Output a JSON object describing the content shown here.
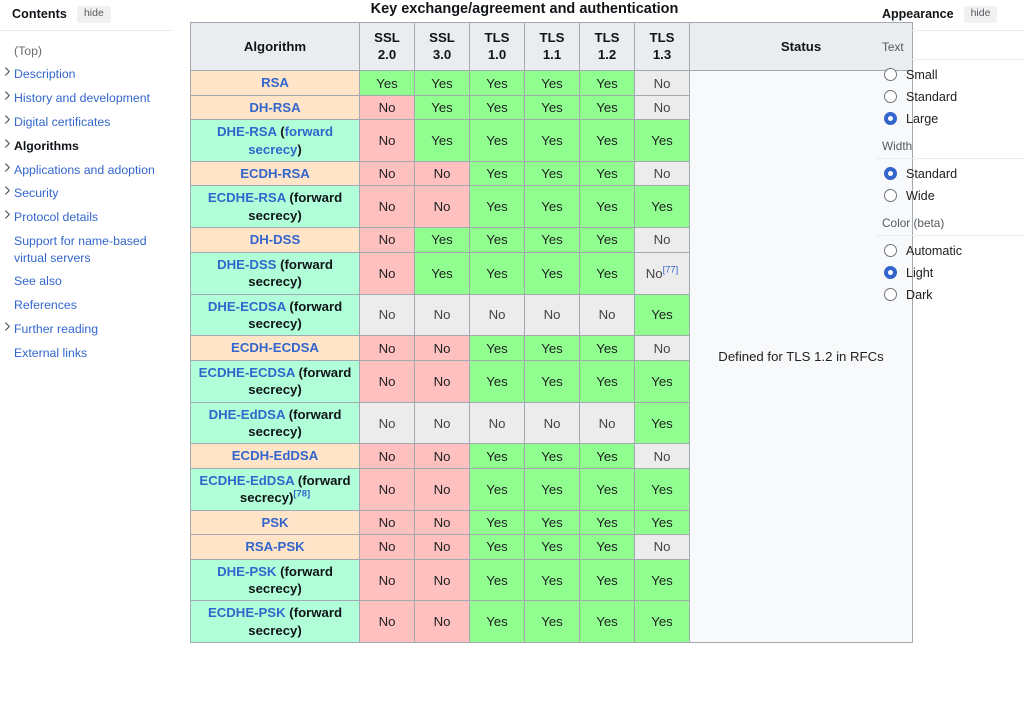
{
  "toc": {
    "title": "Contents",
    "hide_label": "hide",
    "items": [
      {
        "label": "(Top)",
        "expandable": false,
        "selected": false,
        "muted": true
      },
      {
        "label": "Description",
        "expandable": true,
        "selected": false
      },
      {
        "label": "History and development",
        "expandable": true,
        "selected": false
      },
      {
        "label": "Digital certificates",
        "expandable": true,
        "selected": false
      },
      {
        "label": "Algorithms",
        "expandable": true,
        "selected": true
      },
      {
        "label": "Applications and adoption",
        "expandable": true,
        "selected": false
      },
      {
        "label": "Security",
        "expandable": true,
        "selected": false
      },
      {
        "label": "Protocol details",
        "expandable": true,
        "selected": false
      },
      {
        "label": "Support for name-based virtual servers",
        "expandable": false,
        "selected": false
      },
      {
        "label": "See also",
        "expandable": false,
        "selected": false
      },
      {
        "label": "References",
        "expandable": false,
        "selected": false
      },
      {
        "label": "Further reading",
        "expandable": true,
        "selected": false
      },
      {
        "label": "External links",
        "expandable": false,
        "selected": false
      }
    ]
  },
  "table": {
    "caption": "Key exchange/agreement and authentication",
    "headers": [
      "Algorithm",
      "SSL 2.0",
      "SSL 3.0",
      "TLS 1.0",
      "TLS 1.1",
      "TLS 1.2",
      "TLS 1.3",
      "Status"
    ],
    "status_text": "Defined for TLS 1.2 in RFCs",
    "rows": [
      {
        "name": "RSA",
        "name_suffix": "",
        "suffix_link": false,
        "ref": "",
        "forward_secrecy": false,
        "cells": [
          {
            "v": "Yes",
            "c": "yes"
          },
          {
            "v": "Yes",
            "c": "yes"
          },
          {
            "v": "Yes",
            "c": "yes"
          },
          {
            "v": "Yes",
            "c": "yes"
          },
          {
            "v": "Yes",
            "c": "yes"
          },
          {
            "v": "No",
            "c": "grey"
          }
        ]
      },
      {
        "name": "DH-RSA",
        "name_suffix": "",
        "suffix_link": false,
        "ref": "",
        "forward_secrecy": false,
        "cells": [
          {
            "v": "No",
            "c": "no"
          },
          {
            "v": "Yes",
            "c": "yes"
          },
          {
            "v": "Yes",
            "c": "yes"
          },
          {
            "v": "Yes",
            "c": "yes"
          },
          {
            "v": "Yes",
            "c": "yes"
          },
          {
            "v": "No",
            "c": "grey"
          }
        ]
      },
      {
        "name": "DHE-RSA",
        "name_suffix": "(forward secrecy)",
        "suffix_link": true,
        "ref": "",
        "forward_secrecy": true,
        "cells": [
          {
            "v": "No",
            "c": "no"
          },
          {
            "v": "Yes",
            "c": "yes"
          },
          {
            "v": "Yes",
            "c": "yes"
          },
          {
            "v": "Yes",
            "c": "yes"
          },
          {
            "v": "Yes",
            "c": "yes"
          },
          {
            "v": "Yes",
            "c": "yes"
          }
        ]
      },
      {
        "name": "ECDH-RSA",
        "name_suffix": "",
        "suffix_link": false,
        "ref": "",
        "forward_secrecy": false,
        "cells": [
          {
            "v": "No",
            "c": "no"
          },
          {
            "v": "No",
            "c": "no"
          },
          {
            "v": "Yes",
            "c": "yes"
          },
          {
            "v": "Yes",
            "c": "yes"
          },
          {
            "v": "Yes",
            "c": "yes"
          },
          {
            "v": "No",
            "c": "grey"
          }
        ]
      },
      {
        "name": "ECDHE-RSA",
        "name_suffix": "(forward secrecy)",
        "suffix_link": false,
        "ref": "",
        "forward_secrecy": true,
        "cells": [
          {
            "v": "No",
            "c": "no"
          },
          {
            "v": "No",
            "c": "no"
          },
          {
            "v": "Yes",
            "c": "yes"
          },
          {
            "v": "Yes",
            "c": "yes"
          },
          {
            "v": "Yes",
            "c": "yes"
          },
          {
            "v": "Yes",
            "c": "yes"
          }
        ]
      },
      {
        "name": "DH-DSS",
        "name_suffix": "",
        "suffix_link": false,
        "ref": "",
        "forward_secrecy": false,
        "cells": [
          {
            "v": "No",
            "c": "no"
          },
          {
            "v": "Yes",
            "c": "yes"
          },
          {
            "v": "Yes",
            "c": "yes"
          },
          {
            "v": "Yes",
            "c": "yes"
          },
          {
            "v": "Yes",
            "c": "yes"
          },
          {
            "v": "No",
            "c": "grey"
          }
        ]
      },
      {
        "name": "DHE-DSS",
        "name_suffix": "(forward secrecy)",
        "suffix_link": false,
        "ref": "",
        "forward_secrecy": true,
        "cells": [
          {
            "v": "No",
            "c": "no"
          },
          {
            "v": "Yes",
            "c": "yes"
          },
          {
            "v": "Yes",
            "c": "yes"
          },
          {
            "v": "Yes",
            "c": "yes"
          },
          {
            "v": "Yes",
            "c": "yes"
          },
          {
            "v": "No",
            "c": "grey",
            "ref": "[77]"
          }
        ]
      },
      {
        "name": "DHE-ECDSA",
        "name_suffix": "(forward secrecy)",
        "suffix_link": false,
        "ref": "",
        "forward_secrecy": true,
        "cells": [
          {
            "v": "No",
            "c": "grey"
          },
          {
            "v": "No",
            "c": "grey"
          },
          {
            "v": "No",
            "c": "grey"
          },
          {
            "v": "No",
            "c": "grey"
          },
          {
            "v": "No",
            "c": "grey"
          },
          {
            "v": "Yes",
            "c": "yes"
          }
        ]
      },
      {
        "name": "ECDH-ECDSA",
        "name_suffix": "",
        "suffix_link": false,
        "ref": "",
        "forward_secrecy": false,
        "cells": [
          {
            "v": "No",
            "c": "no"
          },
          {
            "v": "No",
            "c": "no"
          },
          {
            "v": "Yes",
            "c": "yes"
          },
          {
            "v": "Yes",
            "c": "yes"
          },
          {
            "v": "Yes",
            "c": "yes"
          },
          {
            "v": "No",
            "c": "grey"
          }
        ]
      },
      {
        "name": "ECDHE-ECDSA",
        "name_suffix": "(forward secrecy)",
        "suffix_link": false,
        "ref": "",
        "forward_secrecy": true,
        "cells": [
          {
            "v": "No",
            "c": "no"
          },
          {
            "v": "No",
            "c": "no"
          },
          {
            "v": "Yes",
            "c": "yes"
          },
          {
            "v": "Yes",
            "c": "yes"
          },
          {
            "v": "Yes",
            "c": "yes"
          },
          {
            "v": "Yes",
            "c": "yes"
          }
        ]
      },
      {
        "name": "DHE-EdDSA",
        "name_suffix": "(forward secrecy)",
        "suffix_link": false,
        "ref": "",
        "forward_secrecy": true,
        "cells": [
          {
            "v": "No",
            "c": "grey"
          },
          {
            "v": "No",
            "c": "grey"
          },
          {
            "v": "No",
            "c": "grey"
          },
          {
            "v": "No",
            "c": "grey"
          },
          {
            "v": "No",
            "c": "grey"
          },
          {
            "v": "Yes",
            "c": "yes"
          }
        ]
      },
      {
        "name": "ECDH-EdDSA",
        "name_suffix": "",
        "suffix_link": false,
        "ref": "",
        "forward_secrecy": false,
        "cells": [
          {
            "v": "No",
            "c": "no"
          },
          {
            "v": "No",
            "c": "no"
          },
          {
            "v": "Yes",
            "c": "yes"
          },
          {
            "v": "Yes",
            "c": "yes"
          },
          {
            "v": "Yes",
            "c": "yes"
          },
          {
            "v": "No",
            "c": "grey"
          }
        ]
      },
      {
        "name": "ECDHE-EdDSA",
        "name_suffix": "(forward secrecy)",
        "suffix_link": false,
        "ref": "[78]",
        "forward_secrecy": true,
        "cells": [
          {
            "v": "No",
            "c": "no"
          },
          {
            "v": "No",
            "c": "no"
          },
          {
            "v": "Yes",
            "c": "yes"
          },
          {
            "v": "Yes",
            "c": "yes"
          },
          {
            "v": "Yes",
            "c": "yes"
          },
          {
            "v": "Yes",
            "c": "yes"
          }
        ]
      },
      {
        "name": "PSK",
        "name_suffix": "",
        "suffix_link": false,
        "ref": "",
        "forward_secrecy": false,
        "cells": [
          {
            "v": "No",
            "c": "no"
          },
          {
            "v": "No",
            "c": "no"
          },
          {
            "v": "Yes",
            "c": "yes"
          },
          {
            "v": "Yes",
            "c": "yes"
          },
          {
            "v": "Yes",
            "c": "yes"
          },
          {
            "v": "Yes",
            "c": "yes"
          }
        ]
      },
      {
        "name": "RSA-PSK",
        "name_suffix": "",
        "suffix_link": false,
        "ref": "",
        "forward_secrecy": false,
        "cells": [
          {
            "v": "No",
            "c": "no"
          },
          {
            "v": "No",
            "c": "no"
          },
          {
            "v": "Yes",
            "c": "yes"
          },
          {
            "v": "Yes",
            "c": "yes"
          },
          {
            "v": "Yes",
            "c": "yes"
          },
          {
            "v": "No",
            "c": "grey"
          }
        ]
      },
      {
        "name": "DHE-PSK",
        "name_suffix": "(forward secrecy)",
        "suffix_link": false,
        "ref": "",
        "forward_secrecy": true,
        "cells": [
          {
            "v": "No",
            "c": "no"
          },
          {
            "v": "No",
            "c": "no"
          },
          {
            "v": "Yes",
            "c": "yes"
          },
          {
            "v": "Yes",
            "c": "yes"
          },
          {
            "v": "Yes",
            "c": "yes"
          },
          {
            "v": "Yes",
            "c": "yes"
          }
        ]
      },
      {
        "name": "ECDHE-PSK",
        "name_suffix": "(forward secrecy)",
        "suffix_link": false,
        "ref": "",
        "forward_secrecy": true,
        "cells": [
          {
            "v": "No",
            "c": "no"
          },
          {
            "v": "No",
            "c": "no"
          },
          {
            "v": "Yes",
            "c": "yes"
          },
          {
            "v": "Yes",
            "c": "yes"
          },
          {
            "v": "Yes",
            "c": "yes"
          },
          {
            "v": "Yes",
            "c": "yes"
          }
        ]
      }
    ]
  },
  "appearance": {
    "title": "Appearance",
    "hide_label": "hide",
    "groups": [
      {
        "label": "Text",
        "options": [
          {
            "label": "Small",
            "selected": false
          },
          {
            "label": "Standard",
            "selected": false
          },
          {
            "label": "Large",
            "selected": true
          }
        ]
      },
      {
        "label": "Width",
        "options": [
          {
            "label": "Standard",
            "selected": true
          },
          {
            "label": "Wide",
            "selected": false
          }
        ]
      },
      {
        "label": "Color (beta)",
        "options": [
          {
            "label": "Automatic",
            "selected": false
          },
          {
            "label": "Light",
            "selected": true
          },
          {
            "label": "Dark",
            "selected": false
          }
        ]
      }
    ]
  },
  "colors": {
    "link": "#3366cc",
    "yes_bg": "#90ff90",
    "no_bg": "#ffc0c0",
    "na_bg": "#ececec",
    "fs_row_bg": "#b0ffd8",
    "nofs_row_bg": "#ffe4c8",
    "header_bg": "#eaecf0",
    "accent": "#3366cc"
  }
}
